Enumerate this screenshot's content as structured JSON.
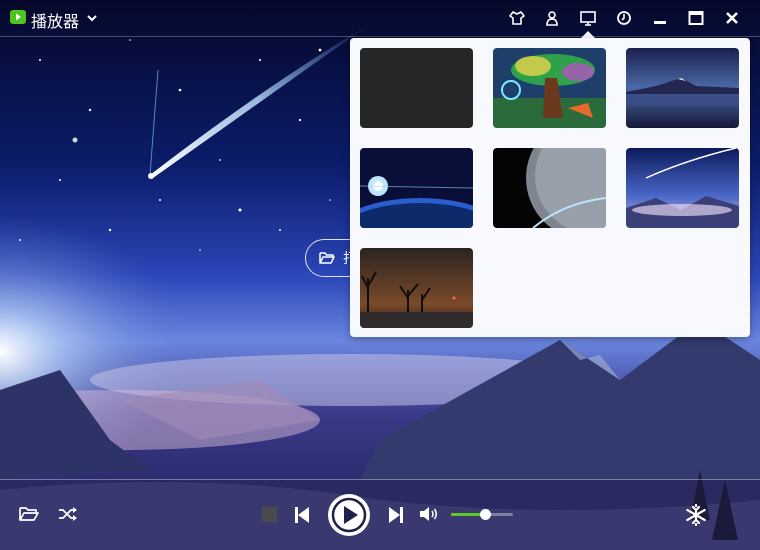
{
  "app": {
    "title": "播放器"
  },
  "window_controls": {
    "icons": [
      "skin-icon",
      "user-icon",
      "monitor-icon",
      "clock-icon",
      "minimize-icon",
      "maximize-icon",
      "close-icon"
    ],
    "active": "monitor-icon"
  },
  "center": {
    "open_button_label": "打开文件",
    "open_button_visible_label": "打"
  },
  "skin_panel": {
    "thumbnails": [
      "dark",
      "fantasy-tree",
      "mountain-lake",
      "earth-sunrise",
      "planet",
      "starry-mountains",
      "night-trees"
    ]
  },
  "controls": {
    "volume": 0.55,
    "accent_color": "#5fcb2a"
  }
}
